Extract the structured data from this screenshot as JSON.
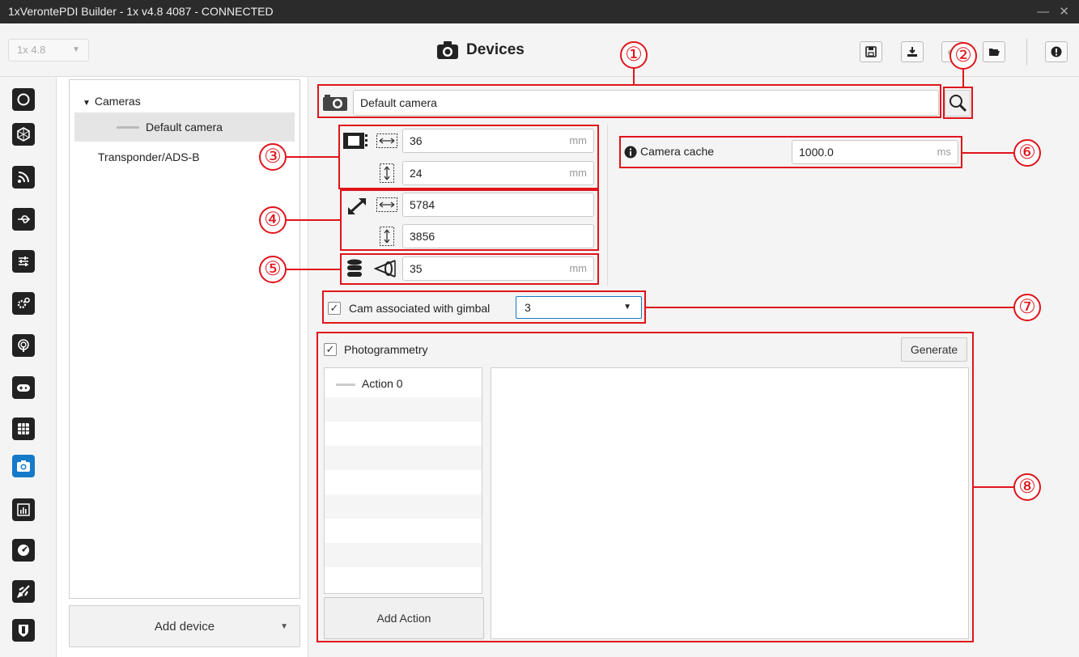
{
  "window": {
    "title": "1xVerontePDI Builder - 1x v4.8 4087 - CONNECTED",
    "controls": "— ✕"
  },
  "toolbar": {
    "version_select": "1x 4.8",
    "page_title": "Devices"
  },
  "tree": {
    "group": "Cameras",
    "selected_item": "Default camera",
    "other_item": "Transponder/ADS-B"
  },
  "add_device_label": "Add device",
  "camera": {
    "name": "Default camera",
    "sensor_width": "36",
    "sensor_height": "24",
    "resolution_width": "5784",
    "resolution_height": "3856",
    "focal_length": "35",
    "length_unit": "mm",
    "cache_label": "Camera cache",
    "cache_value": "1000.0",
    "cache_unit": "ms",
    "gimbal_label": "Cam associated with gimbal",
    "gimbal_value": "3",
    "gimbal_checked": true
  },
  "photogrammetry": {
    "label": "Photogrammetry",
    "checked": true,
    "generate_label": "Generate",
    "actions": [
      "Action 0"
    ],
    "add_action_label": "Add Action"
  },
  "callouts": [
    "①",
    "②",
    "③",
    "④",
    "⑤",
    "⑥",
    "⑦",
    "⑧"
  ],
  "colors": {
    "accent": "#1679c9",
    "annotation": "#e0141b",
    "titlebar": "#2b2b2b"
  }
}
